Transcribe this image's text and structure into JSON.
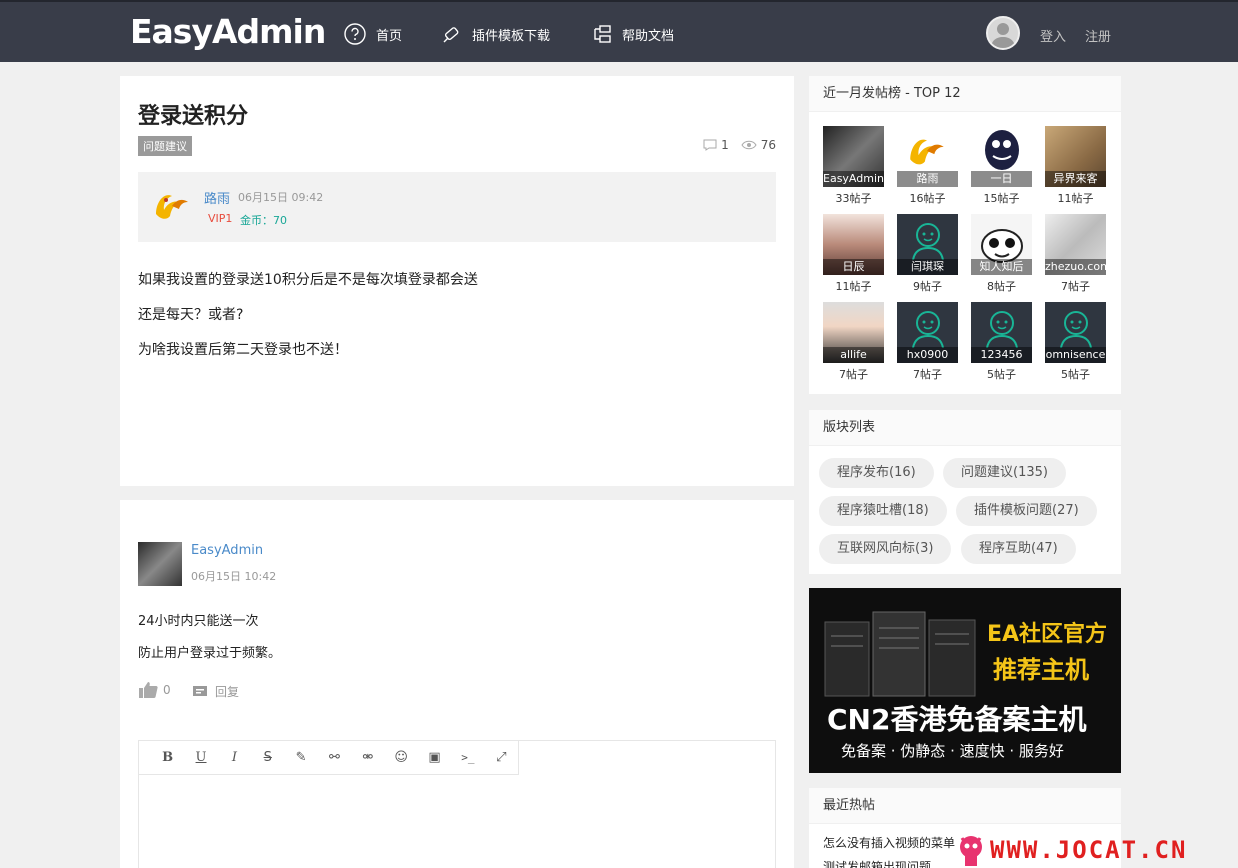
{
  "brand": {
    "logo": "EasyAdmin"
  },
  "nav": [
    {
      "label": "首页",
      "icon": "help-circle-icon"
    },
    {
      "label": "插件模板下载",
      "icon": "plugin-icon"
    },
    {
      "label": "帮助文档",
      "icon": "doc-tree-icon"
    }
  ],
  "user": {
    "login": "登入",
    "register": "注册"
  },
  "post": {
    "title": "登录送积分",
    "tag": "问题建议",
    "comments": "1",
    "views": "76",
    "author": "路雨",
    "time": "06月15日 09:42",
    "vip": "VIP1",
    "coins": "金币：70",
    "body": [
      "如果我设置的登录送10积分后是不是每次填登录都会送",
      "还是每天？或者?",
      "为啥我设置后第二天登录也不送！"
    ]
  },
  "reply": {
    "author": "EasyAdmin",
    "time": "06月15日 10:42",
    "body": [
      "24小时内只能送一次",
      "防止用户登录过于频繁。"
    ],
    "likes": "0",
    "reply_label": "回复"
  },
  "editor": {
    "tools": [
      "B",
      "U",
      "I",
      "S",
      "✎",
      "⚯",
      "⚮",
      "☺",
      "▣",
      ">_",
      "⤢"
    ]
  },
  "top_posters": {
    "title": "近一月发帖榜 - TOP 12",
    "users": [
      {
        "name": "EasyAdmin",
        "count": "33帖子"
      },
      {
        "name": "路雨",
        "count": "16帖子"
      },
      {
        "name": "一日",
        "count": "15帖子"
      },
      {
        "name": "异界来客",
        "count": "11帖子"
      },
      {
        "name": "日辰",
        "count": "11帖子"
      },
      {
        "name": "闫琪琛",
        "count": "9帖子"
      },
      {
        "name": "知人知后",
        "count": "8帖子"
      },
      {
        "name": "zhezuo.com",
        "count": "7帖子"
      },
      {
        "name": "allife",
        "count": "7帖子"
      },
      {
        "name": "hx0900",
        "count": "7帖子"
      },
      {
        "name": "123456",
        "count": "5帖子"
      },
      {
        "name": "omnisence",
        "count": "5帖子"
      }
    ]
  },
  "forums": {
    "title": "版块列表",
    "items": [
      "程序发布(16)",
      "问题建议(135)",
      "程序猿吐槽(18)",
      "插件模板问题(27)",
      "互联网风向标(3)",
      "程序互助(47)"
    ]
  },
  "ad": {
    "line1": "EA社区官方",
    "line2": "推荐主机",
    "line3": "CN2香港免备案主机",
    "line4": "免备案 · 伪静态 · 速度快 · 服务好"
  },
  "hot": {
    "title": "最近热帖",
    "items": [
      "怎么没有插入视频的菜单",
      "测试发邮箱出现问题"
    ]
  },
  "watermark": "WWW.JOCAT.CN",
  "colors": {
    "topbar": "#393d49",
    "link": "#4a8ac9",
    "vip": "#e84c3d",
    "coin": "#19a797"
  }
}
